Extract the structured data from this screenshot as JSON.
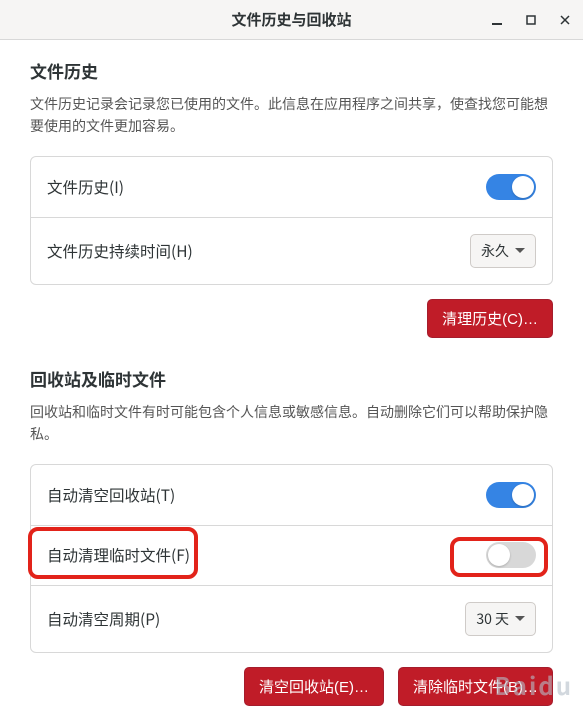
{
  "window": {
    "title": "文件历史与回收站"
  },
  "section1": {
    "title": "文件历史",
    "desc": "文件历史记录会记录您已使用的文件。此信息在应用程序之间共享，使查找您可能想要使用的文件更加容易。",
    "row1": {
      "label": "文件历史(I)"
    },
    "row2": {
      "label": "文件历史持续时间(H)",
      "dropdown": "永久"
    },
    "clear_btn": "清理历史(C)…"
  },
  "section2": {
    "title": "回收站及临时文件",
    "desc": "回收站和临时文件有时可能包含个人信息或敏感信息。自动删除它们可以帮助保护隐私。",
    "row1": {
      "label": "自动清空回收站(T)"
    },
    "row2": {
      "label": "自动清理临时文件(F)"
    },
    "row3": {
      "label": "自动清空周期(P)",
      "dropdown": "30 天"
    },
    "empty_trash_btn": "清空回收站(E)…",
    "purge_temp_btn": "清除临时文件(B)…"
  },
  "watermark": "Baidu"
}
